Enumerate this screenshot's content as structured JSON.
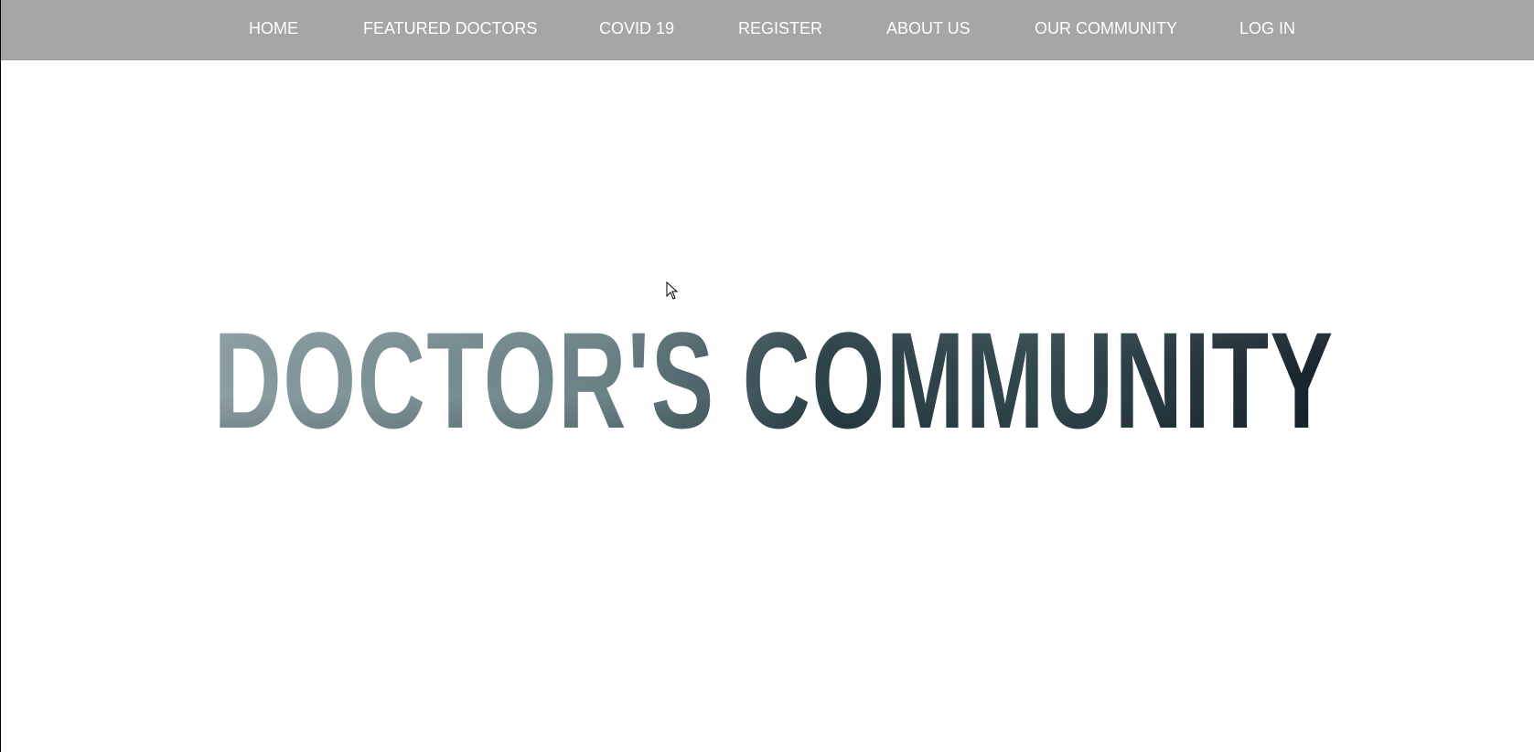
{
  "nav": {
    "items": [
      {
        "label": "HOME",
        "name": "nav-home"
      },
      {
        "label": "FEATURED DOCTORS",
        "name": "nav-featured-doctors"
      },
      {
        "label": "COVID 19",
        "name": "nav-covid-19"
      },
      {
        "label": "REGISTER",
        "name": "nav-register"
      },
      {
        "label": "ABOUT US",
        "name": "nav-about-us"
      },
      {
        "label": "OUR COMMUNITY",
        "name": "nav-our-community"
      },
      {
        "label": "LOG IN",
        "name": "nav-log-in"
      }
    ]
  },
  "hero": {
    "title": "DOCTOR'S COMMUNITY"
  },
  "colors": {
    "navbar_bg": "#a6a6a6",
    "nav_text": "#ffffff",
    "page_bg": "#ffffff",
    "hero_fill_light": "#7f9699",
    "hero_fill_dark": "#1f2f3a"
  }
}
